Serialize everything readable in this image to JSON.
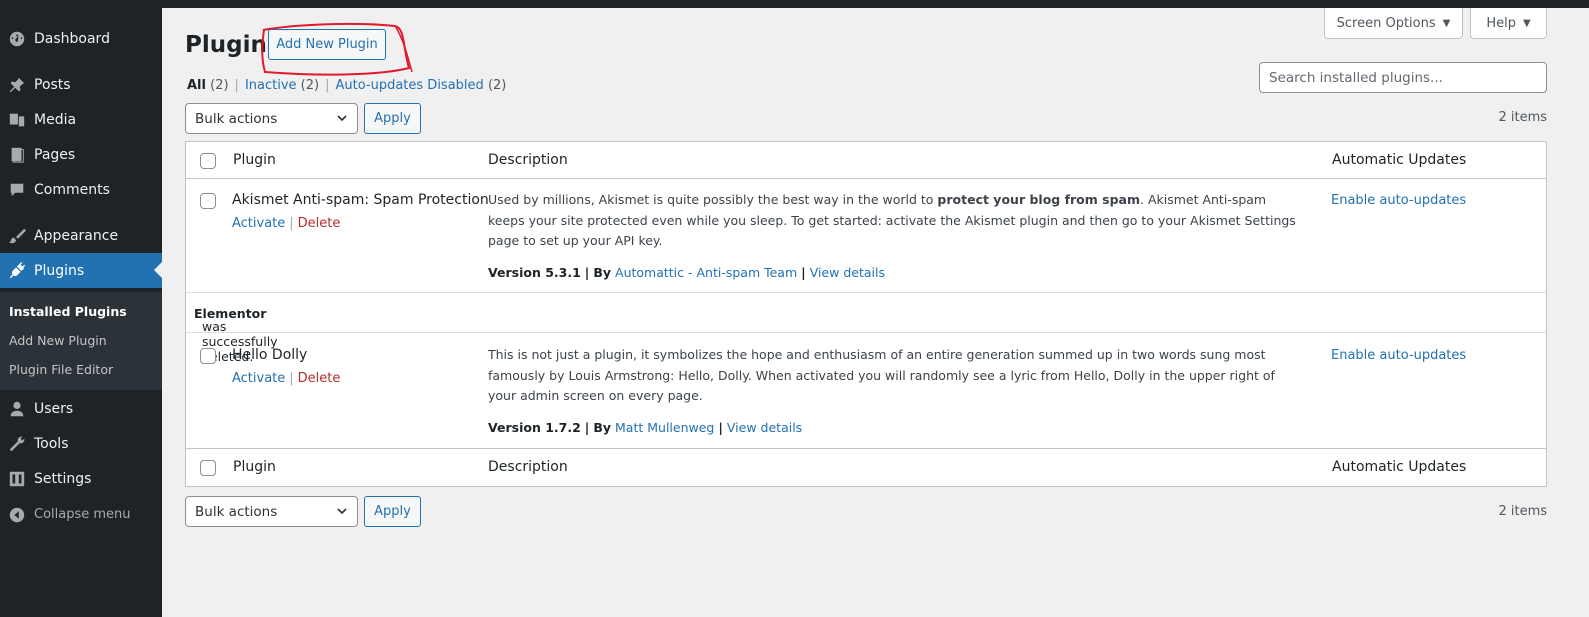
{
  "sidebar": {
    "items": [
      {
        "label": "Dashboard",
        "icon": "dashboard-icon"
      },
      {
        "label": "Posts",
        "icon": "pin-icon"
      },
      {
        "label": "Media",
        "icon": "media-icon"
      },
      {
        "label": "Pages",
        "icon": "pages-icon"
      },
      {
        "label": "Comments",
        "icon": "comment-icon"
      },
      {
        "label": "Appearance",
        "icon": "brush-icon"
      },
      {
        "label": "Plugins",
        "icon": "plug-icon"
      },
      {
        "label": "Users",
        "icon": "user-icon"
      },
      {
        "label": "Tools",
        "icon": "wrench-icon"
      },
      {
        "label": "Settings",
        "icon": "settings-icon"
      },
      {
        "label": "Collapse menu",
        "icon": "collapse-icon"
      }
    ],
    "submenu": [
      "Installed Plugins",
      "Add New Plugin",
      "Plugin File Editor"
    ]
  },
  "header": {
    "title": "Plugins",
    "add_new": "Add New Plugin",
    "screen_options": "Screen Options",
    "help": "Help"
  },
  "filters": {
    "all": "All",
    "all_count": "(2)",
    "inactive": "Inactive",
    "inactive_count": "(2)",
    "auto_disabled": "Auto-updates Disabled",
    "auto_disabled_count": "(2)"
  },
  "search": {
    "placeholder": "Search installed plugins..."
  },
  "toolbar": {
    "bulk": "Bulk actions",
    "apply": "Apply",
    "count": "2 items"
  },
  "table": {
    "col_plugin": "Plugin",
    "col_description": "Description",
    "col_auto": "Automatic Updates",
    "plugins": [
      {
        "name": "Akismet Anti-spam: Spam Protection",
        "activate": "Activate",
        "delete": "Delete",
        "desc_pre": "Used by millions, Akismet is quite possibly the best way in the world to ",
        "desc_bold": "protect your blog from spam",
        "desc_post": ". Akismet Anti-spam keeps your site protected even while you sleep. To get started: activate the Akismet plugin and then go to your Akismet Settings page to set up your API key.",
        "version": "Version 5.3.1",
        "by": "By",
        "author": "Automattic - Anti-spam Team",
        "details": "View details",
        "auto": "Enable auto-updates"
      },
      {
        "name": "Hello Dolly",
        "activate": "Activate",
        "delete": "Delete",
        "desc": "This is not just a plugin, it symbolizes the hope and enthusiasm of an entire generation summed up in two words sung most famously by Louis Armstrong: Hello, Dolly. When activated you will randomly see a lyric from Hello, Dolly in the upper right of your admin screen on every page.",
        "version": "Version 1.7.2",
        "by": "By",
        "author": "Matt Mullenweg",
        "details": "View details",
        "auto": "Enable auto-updates"
      }
    ],
    "notice_bold": "Elementor",
    "notice_rest": " was successfully deleted."
  }
}
